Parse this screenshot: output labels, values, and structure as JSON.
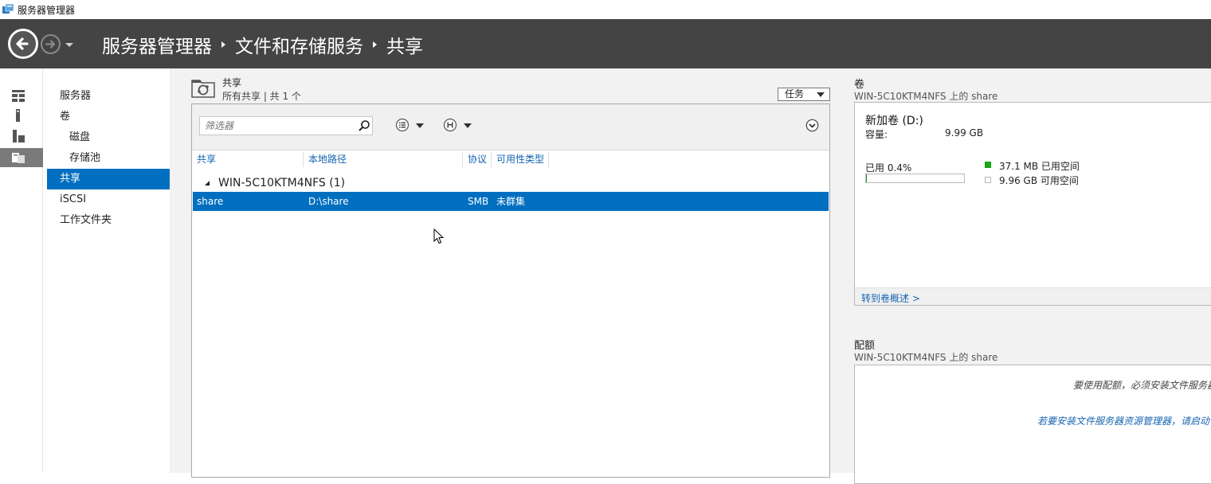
{
  "window": {
    "title": "服务器管理器",
    "icon": "server-manager-icon"
  },
  "header": {
    "breadcrumb": [
      "服务器管理器",
      "文件和存储服务",
      "共享"
    ],
    "back_icon": "back-arrow-icon",
    "forward_icon": "forward-arrow-icon"
  },
  "nav": {
    "items": [
      {
        "label": "服务器"
      },
      {
        "label": "卷"
      },
      {
        "label": "磁盘"
      },
      {
        "label": "存储池"
      },
      {
        "label": "共享",
        "selected": true
      },
      {
        "label": "iSCSI"
      },
      {
        "label": "工作文件夹"
      }
    ]
  },
  "shares": {
    "title": "共享",
    "subtitle": "所有共享 | 共 1 个",
    "tasks_label": "任务",
    "filter_placeholder": "筛选器",
    "columns": [
      "共享",
      "本地路径",
      "协议",
      "可用性类型"
    ],
    "group": "WIN-5C10KTM4NFS (1)",
    "rows": [
      {
        "share": "share",
        "path": "D:\\share",
        "protocol": "SMB",
        "availability": "未群集"
      }
    ]
  },
  "volume": {
    "title": "卷",
    "subtitle": "WIN-5C10KTM4NFS 上的 share",
    "name": "新加卷 (D:)",
    "capacity_label": "容量:",
    "capacity_value": "9.99 GB",
    "used_percent_label": "已用 0.4%",
    "used_fraction": 0.004,
    "used_space": "37.1 MB 已用空间",
    "free_space": "9.96 GB 可用空间",
    "goto_link": "转到卷概述 >"
  },
  "quota": {
    "title": "配额",
    "subtitle": "WIN-5C10KTM4NFS 上的 share",
    "message": "要使用配额，必须安装文件服务器",
    "install_link": "若要安装文件服务器资源管理器，请启动"
  },
  "colors": {
    "header_bg": "#444444",
    "selection": "#006fc0",
    "link": "#1565b0",
    "used": "#19a619"
  }
}
